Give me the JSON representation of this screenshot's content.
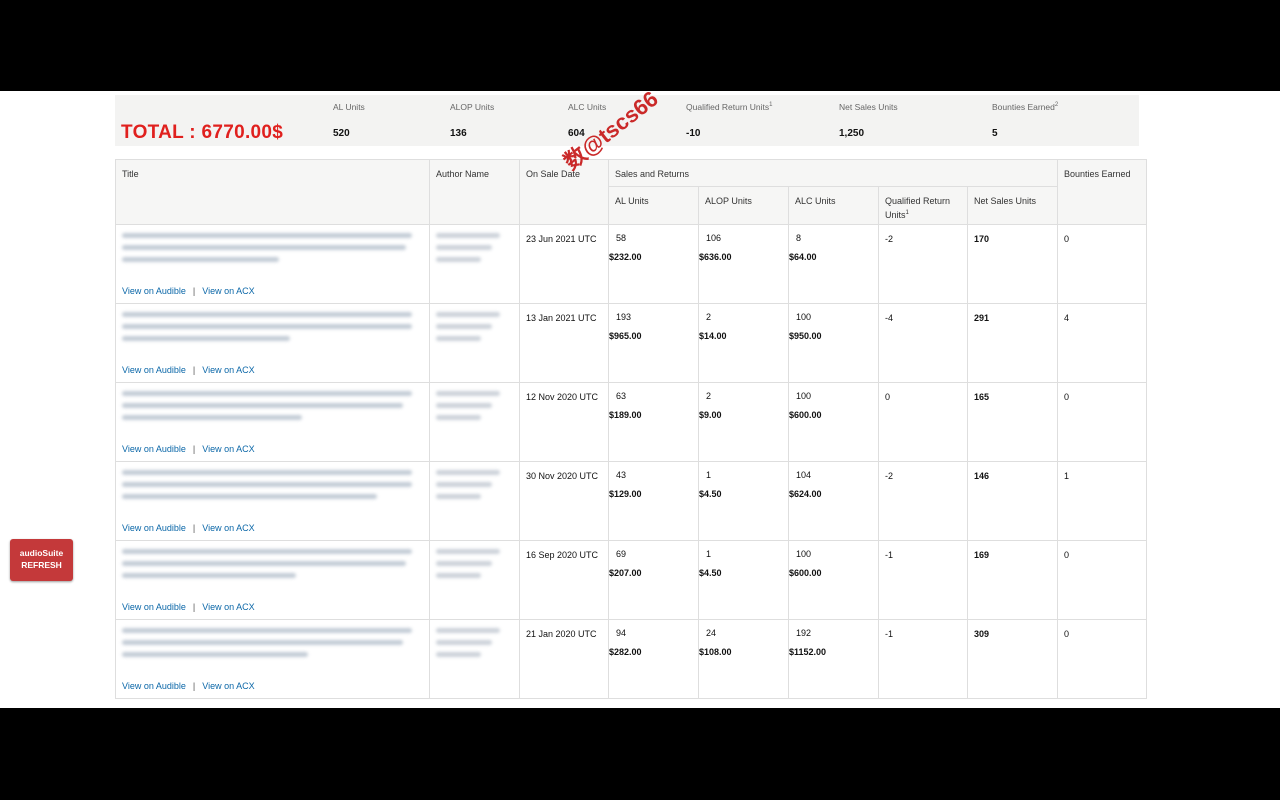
{
  "summary": {
    "total": "TOTAL : 6770.00$",
    "columns": [
      {
        "label": "AL Units",
        "sup": "",
        "value": "520"
      },
      {
        "label": "ALOP Units",
        "sup": "",
        "value": "136"
      },
      {
        "label": "ALC Units",
        "sup": "",
        "value": "604"
      },
      {
        "label": "Qualified Return Units",
        "sup": "1",
        "value": "-10"
      },
      {
        "label": "Net Sales Units",
        "sup": "",
        "value": "1,250"
      },
      {
        "label": "Bounties Earned",
        "sup": "2",
        "value": "5"
      }
    ]
  },
  "watermark": "数@tscs66",
  "table": {
    "headers": {
      "title": "Title",
      "author": "Author Name",
      "on_sale": "On Sale Date",
      "sales_returns": "Sales and Returns",
      "bounties": "Bounties Earned",
      "al": "AL Units",
      "alop": "ALOP Units",
      "alc": "ALC Units",
      "qr": "Qualified Return Units",
      "qr_sup": "1",
      "net": "Net Sales Units"
    },
    "link_audible": "View on Audible",
    "link_sep": "|",
    "link_acx": "View on ACX",
    "rows": [
      {
        "date": "23 Jun 2021 UTC",
        "al": "58",
        "al_money": "$232.00",
        "alop": "106",
        "alop_money": "$636.00",
        "alc": "8",
        "alc_money": "$64.00",
        "qr": "-2",
        "net": "170",
        "bounties": "0"
      },
      {
        "date": "13 Jan 2021 UTC",
        "al": "193",
        "al_money": "$965.00",
        "alop": "2",
        "alop_money": "$14.00",
        "alc": "100",
        "alc_money": "$950.00",
        "qr": "-4",
        "net": "291",
        "bounties": "4"
      },
      {
        "date": "12 Nov 2020 UTC",
        "al": "63",
        "al_money": "$189.00",
        "alop": "2",
        "alop_money": "$9.00",
        "alc": "100",
        "alc_money": "$600.00",
        "qr": "0",
        "net": "165",
        "bounties": "0"
      },
      {
        "date": "30 Nov 2020 UTC",
        "al": "43",
        "al_money": "$129.00",
        "alop": "1",
        "alop_money": "$4.50",
        "alc": "104",
        "alc_money": "$624.00",
        "qr": "-2",
        "net": "146",
        "bounties": "1"
      },
      {
        "date": "16 Sep 2020 UTC",
        "al": "69",
        "al_money": "$207.00",
        "alop": "1",
        "alop_money": "$4.50",
        "alc": "100",
        "alc_money": "$600.00",
        "qr": "-1",
        "net": "169",
        "bounties": "0"
      },
      {
        "date": "21 Jan 2020 UTC",
        "al": "94",
        "al_money": "$282.00",
        "alop": "24",
        "alop_money": "$108.00",
        "alc": "192",
        "alc_money": "$1152.00",
        "qr": "-1",
        "net": "309",
        "bounties": "0"
      }
    ]
  },
  "side_button": {
    "line1": "audioSuite",
    "line2": "REFRESH"
  },
  "colors": {
    "total": "#e0201e",
    "link": "#0b67a8",
    "button": "#c4393a",
    "watermark": "#c81f1f"
  }
}
